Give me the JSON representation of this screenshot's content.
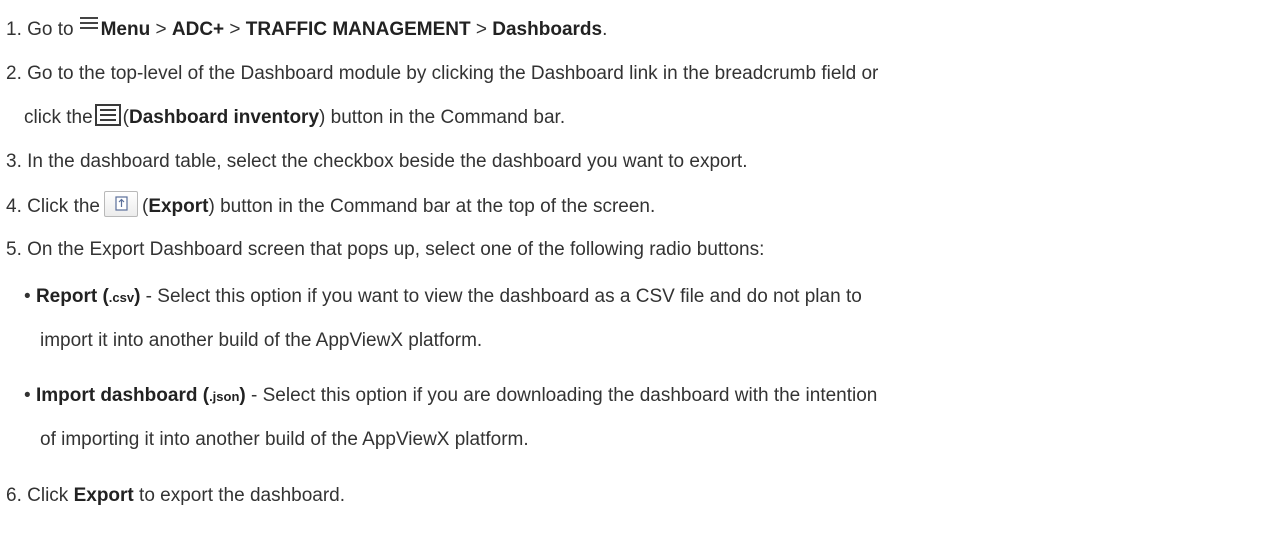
{
  "steps": {
    "s1": {
      "num": "1. Go to",
      "menu": "Menu",
      "sep1": " > ",
      "adc": "ADC+",
      "sep2": " > ",
      "tm": "TRAFFIC MANAGEMENT",
      "sep3": " > ",
      "dash": "Dashboards",
      "end": "."
    },
    "s2": {
      "line1": "2. Go to the top-level of the Dashboard module by clicking the Dashboard link in the breadcrumb field or",
      "pre": "click the",
      "open": "(",
      "label": "Dashboard inventory",
      "post": ") button in the Command bar."
    },
    "s3": {
      "text": "3. In the dashboard table, select the checkbox beside the dashboard you want to export."
    },
    "s4": {
      "pre": "4. Click the",
      "open": "(",
      "label": "Export",
      "post": ") button in the Command bar at the top of the screen."
    },
    "s5": {
      "text": "5. On the Export Dashboard screen that pops up, select one of the following radio buttons:"
    },
    "options": {
      "report": {
        "bullet": "• ",
        "label": "Report (",
        "ext": ".csv",
        "close": ")",
        "line1_rest": " - Select this option if you want to view the dashboard as a CSV file and do not plan to",
        "line2": "import it into another build of the AppViewX platform."
      },
      "import": {
        "bullet": "• ",
        "label": "Import dashboard (",
        "ext": ".json",
        "close": ")",
        "line1_rest": " - Select this option if you are downloading the dashboard with the intention",
        "line2": "of importing it into another build of the AppViewX platform."
      }
    },
    "s6": {
      "pre": "6. Click ",
      "label": "Export",
      "post": " to export the dashboard."
    }
  },
  "icons": {
    "menu": "hamburger-menu-icon",
    "inventory": "dashboard-inventory-icon",
    "export": "export-icon"
  }
}
